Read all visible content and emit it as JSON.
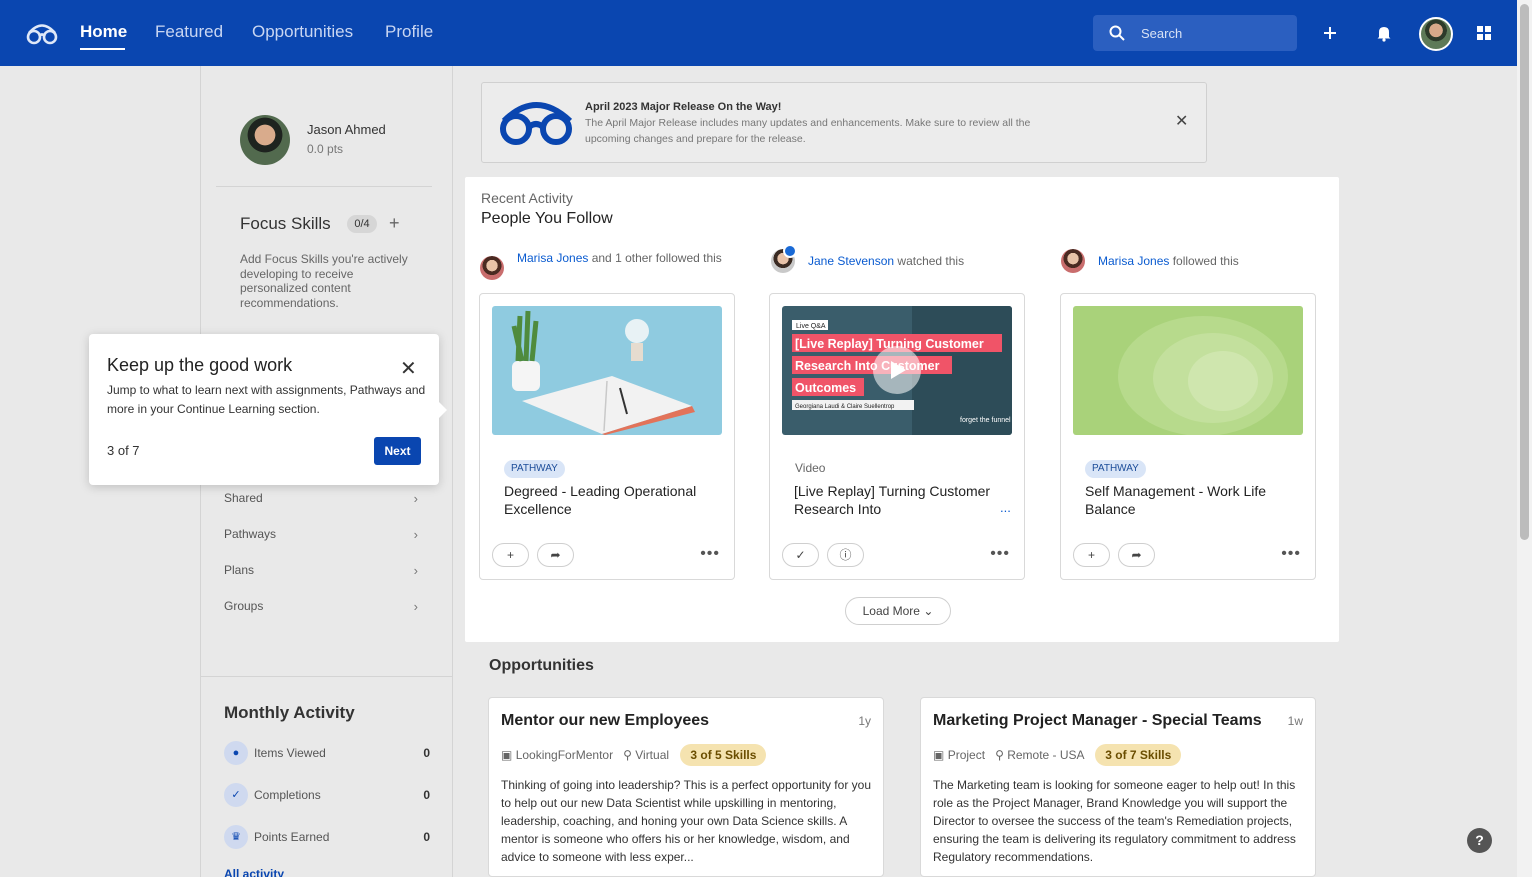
{
  "nav": {
    "links": [
      "Home",
      "Featured",
      "Opportunities",
      "Profile"
    ],
    "search_placeholder": "Search"
  },
  "profile": {
    "name": "Jason Ahmed",
    "points": "0.0 pts"
  },
  "focus": {
    "title": "Focus Skills",
    "count": "0/4",
    "description": "Add Focus Skills you're actively developing to receive personalized content recommendations."
  },
  "sidebar_items": [
    "Shared",
    "Pathways",
    "Plans",
    "Groups"
  ],
  "monthly": {
    "title": "Monthly Activity",
    "stats": [
      {
        "label": "Items Viewed",
        "value": "0",
        "icon": "eye-icon"
      },
      {
        "label": "Completions",
        "value": "0",
        "icon": "check-icon"
      },
      {
        "label": "Points Earned",
        "value": "0",
        "icon": "trophy-icon"
      }
    ],
    "all_activity": "All activity"
  },
  "banner": {
    "title": "April 2023 Major Release On the Way!",
    "text": "The April Major Release includes many updates and enhancements. Make sure to review all the upcoming changes and prepare for the release."
  },
  "recent": {
    "subtitle": "Recent Activity",
    "title": "People You Follow",
    "feed": [
      {
        "who": "Marisa Jones",
        "rest": " and 1 other followed this",
        "tag": "PATHWAY",
        "title": "Degreed - Leading Operational Excellence"
      },
      {
        "who": "Jane Stevenson",
        "rest": " watched this",
        "type": "Video",
        "title": "[Live Replay] Turning Customer Research Into",
        "ellipsis": "..."
      },
      {
        "who": "Marisa Jones",
        "rest": " followed this",
        "tag": "PATHWAY",
        "title": "Self Management - Work Life Balance"
      }
    ],
    "video_overlay": {
      "badge": "Live Q&A",
      "lines": [
        "[Live Replay] Turning Customer",
        "Research Into Customer",
        "Outcomes"
      ],
      "credits": "Georgiana Laudi & Claire Suellentrop",
      "brand": "forget the funnel"
    },
    "load_more": "Load More"
  },
  "opportunities": {
    "title": "Opportunities",
    "items": [
      {
        "name": "Mentor our new Employees",
        "age": "1y",
        "type": "LookingForMentor",
        "location": "Virtual",
        "skills": "3 of 5 Skills",
        "desc": "Thinking of going into leadership? This is a perfect opportunity for you to help out our new Data Scientist while upskilling in mentoring, leadership, coaching, and honing your own Data Science skills. A mentor is someone who offers his or her knowledge, wisdom, and advice to someone with less exper..."
      },
      {
        "name": "Marketing Project Manager - Special Teams",
        "age": "1w",
        "type": "Project",
        "location": "Remote - USA",
        "skills": "3 of 7 Skills",
        "desc": "The Marketing team is looking for someone eager to help out! In this role as the Project Manager, Brand Knowledge you will support the Director to oversee the success of the team's Remediation projects, ensuring the team is delivering its regulatory commitment to address Regulatory recommendations."
      }
    ]
  },
  "coach": {
    "title": "Keep up the good work",
    "text": "Jump to what to learn next with assignments, Pathways and more in your Continue Learning section.",
    "step": "3 of 7",
    "next": "Next"
  },
  "help": "?",
  "colors": {
    "brand": "#0a46b0",
    "link": "#0a5bd0",
    "skill_badge": "#f5e3b0"
  }
}
